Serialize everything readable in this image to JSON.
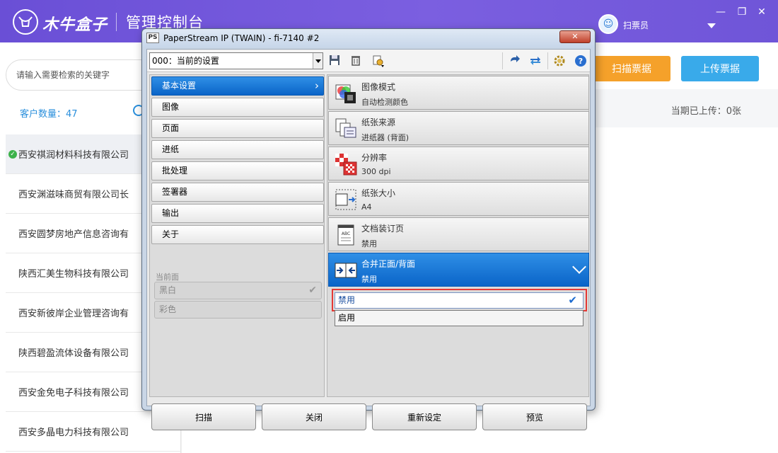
{
  "app": {
    "brand": "木牛盒子",
    "title": "管理控制台",
    "user": "扫票员"
  },
  "sidebar": {
    "search_placeholder": "请输入需要检索的关键字",
    "customer_count": "客户数量：47",
    "customers": [
      "西安祺润材料科技有限公司",
      "西安渊滋味商贸有限公司长",
      "西安圆梦房地产信息咨询有",
      "陕西汇美生物科技有限公司",
      "西安新彼岸企业管理咨询有",
      "陕西碧盈流体设备有限公司",
      "西安金免电子科技有限公司",
      "西安多晶电力科技有限公司"
    ]
  },
  "main": {
    "scan_button": "扫描票据",
    "upload_button": "上传票据",
    "upload_count": "当期已上传：0张"
  },
  "dialog": {
    "title": "PaperStream IP (TWAIN) - fi-7140 #2",
    "ps_badge": "PS",
    "preset": "000：当前的设置",
    "nav": [
      "基本设置",
      "图像",
      "页面",
      "进纸",
      "批处理",
      "签署器",
      "输出",
      "关于"
    ],
    "current_side_label": "当前面",
    "side_options": [
      "黑白",
      "彩色"
    ],
    "settings": [
      {
        "title": "图像模式",
        "value": "自动检测颜色"
      },
      {
        "title": "纸张来源",
        "value": "进纸器 (背面)"
      },
      {
        "title": "分辨率",
        "value": "300 dpi"
      },
      {
        "title": "纸张大小",
        "value": "A4"
      },
      {
        "title": "文档装订页",
        "value": "禁用"
      },
      {
        "title": "合并正面/背面",
        "value": "禁用"
      }
    ],
    "merge_options": [
      "禁用",
      "启用"
    ],
    "footer": [
      "扫描",
      "关闭",
      "重新设定",
      "预览"
    ]
  },
  "colors": {
    "header": "#6a4fd6",
    "selected_blue": "#0a64c8",
    "scan_orange": "#f5a12a",
    "upload_blue": "#39aaea",
    "highlight_red": "#e53935"
  }
}
